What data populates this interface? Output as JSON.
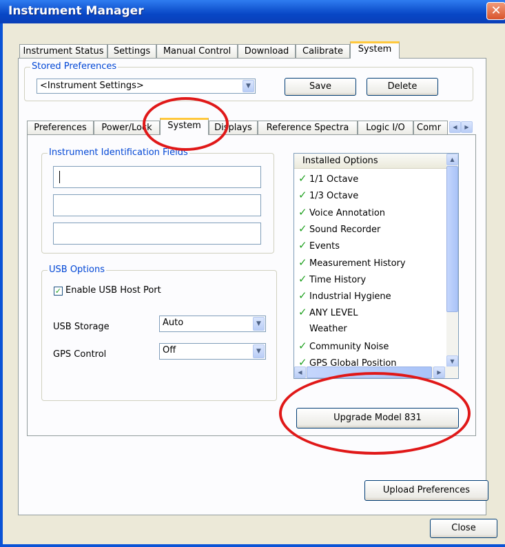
{
  "window": {
    "title": "Instrument Manager",
    "close_glyph": "✕"
  },
  "top_tabs": [
    "Instrument Status",
    "Settings",
    "Manual Control",
    "Download",
    "Calibrate",
    "System"
  ],
  "stored_preferences": {
    "label": "Stored Preferences",
    "selected": "<Instrument Settings>",
    "save": "Save",
    "delete": "Delete"
  },
  "sub_tabs": [
    "Preferences",
    "Power/Lock",
    "System",
    "Displays",
    "Reference Spectra",
    "Logic I/O",
    "Comr"
  ],
  "identification": {
    "label": "Instrument Identification Fields",
    "fields": [
      "",
      "",
      ""
    ]
  },
  "usb": {
    "label": "USB Options",
    "enable_host_port": "Enable USB Host Port",
    "enable_checked": true,
    "storage_label": "USB Storage",
    "storage_value": "Auto",
    "gps_label": "GPS Control",
    "gps_value": "Off"
  },
  "installed_options": {
    "header": "Installed Options",
    "items": [
      {
        "label": "1/1 Octave",
        "checked": true
      },
      {
        "label": "1/3 Octave",
        "checked": true
      },
      {
        "label": "Voice Annotation",
        "checked": true
      },
      {
        "label": "Sound Recorder",
        "checked": true
      },
      {
        "label": "Events",
        "checked": true
      },
      {
        "label": "Measurement History",
        "checked": true
      },
      {
        "label": "Time History",
        "checked": true
      },
      {
        "label": "Industrial Hygiene",
        "checked": true
      },
      {
        "label": "ANY LEVEL",
        "checked": true
      },
      {
        "label": "Weather",
        "checked": false
      },
      {
        "label": "Community Noise",
        "checked": true
      },
      {
        "label": "GPS Global Position",
        "checked": true
      }
    ]
  },
  "buttons": {
    "upgrade": "Upgrade Model 831",
    "upload": "Upload Preferences",
    "close": "Close"
  },
  "colors": {
    "titlebar": "#0a53d6",
    "annotation": "#e01818",
    "accent_tab": "#ffc83c"
  }
}
